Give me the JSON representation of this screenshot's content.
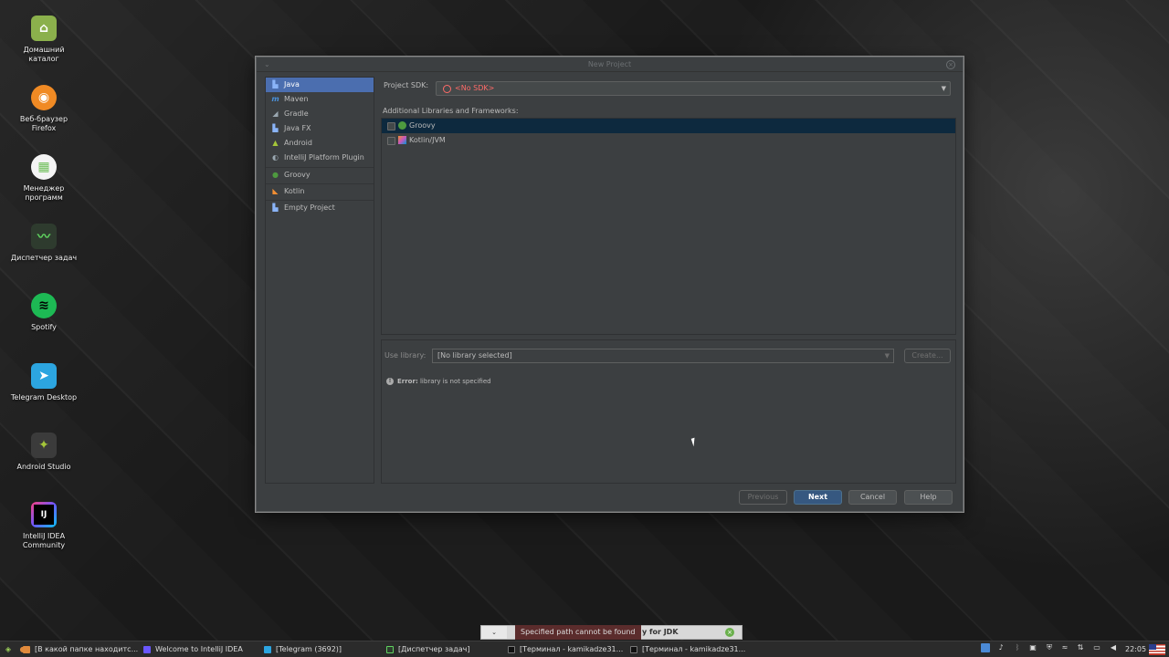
{
  "desktop": {
    "icons": [
      {
        "label": "Домашний каталог",
        "icon": "home-folder-icon",
        "color": "#8bb04c"
      },
      {
        "label": "Веб-браузер Firefox",
        "icon": "firefox-icon",
        "color": "#f08a24"
      },
      {
        "label": "Менеджер программ",
        "icon": "software-manager-icon",
        "color": "#6fbf5a"
      },
      {
        "label": "Диспетчер задач",
        "icon": "task-manager-icon",
        "color": "#2e3b2e"
      },
      {
        "label": "Spotify",
        "icon": "spotify-icon",
        "color": "#1db954"
      },
      {
        "label": "Telegram Desktop",
        "icon": "telegram-icon",
        "color": "#2ca5e0"
      },
      {
        "label": "Android Studio",
        "icon": "android-studio-icon",
        "color": "#3b3b3b"
      },
      {
        "label": "IntelliJ IDEA Community",
        "icon": "intellij-icon",
        "color": "#1a1a4a"
      }
    ]
  },
  "dialog": {
    "title": "New Project",
    "project_types": [
      {
        "label": "Java",
        "icon": "folder-icon",
        "selected": true
      },
      {
        "label": "Maven",
        "icon": "maven-icon"
      },
      {
        "label": "Gradle",
        "icon": "gradle-icon"
      },
      {
        "label": "Java FX",
        "icon": "folder-icon"
      },
      {
        "label": "Android",
        "icon": "android-icon"
      },
      {
        "label": "IntelliJ Platform Plugin",
        "icon": "plugin-icon"
      },
      {
        "label": "Groovy",
        "icon": "groovy-icon"
      },
      {
        "label": "Kotlin",
        "icon": "kotlin-icon"
      },
      {
        "label": "Empty Project",
        "icon": "folder-icon"
      }
    ],
    "sdk_label": "Project SDK:",
    "sdk_value": "<No SDK>",
    "libs_label": "Additional Libraries and Frameworks:",
    "libraries": [
      {
        "label": "Groovy",
        "icon": "groovy-icon",
        "checked": false,
        "selected": true
      },
      {
        "label": "Kotlin/JVM",
        "icon": "kotlin-icon",
        "checked": false,
        "selected": false
      }
    ],
    "use_library_label": "Use library:",
    "use_library_value": "[No library selected]",
    "create_label": "Create...",
    "error_label": "Error:",
    "error_text": "library is not specified",
    "buttons": {
      "previous": "Previous",
      "next": "Next",
      "cancel": "Cancel",
      "help": "Help"
    }
  },
  "notification": {
    "toast": "Specified path cannot be found",
    "text": "y for JDK"
  },
  "taskbar": {
    "tasks": [
      {
        "label": "[В какой папке находитс...",
        "icon": "browser-icon"
      },
      {
        "label": "Welcome to IntelliJ IDEA",
        "icon": "intellij-icon"
      },
      {
        "label": "[Telegram (3692)]",
        "icon": "telegram-icon"
      },
      {
        "label": "[Диспетчер задач]",
        "icon": "task-manager-icon"
      },
      {
        "label": "[Терминал - kamikadze31...",
        "icon": "terminal-icon"
      },
      {
        "label": "[Терминал - kamikadze31...",
        "icon": "terminal-icon"
      }
    ],
    "clock": "22:05"
  }
}
